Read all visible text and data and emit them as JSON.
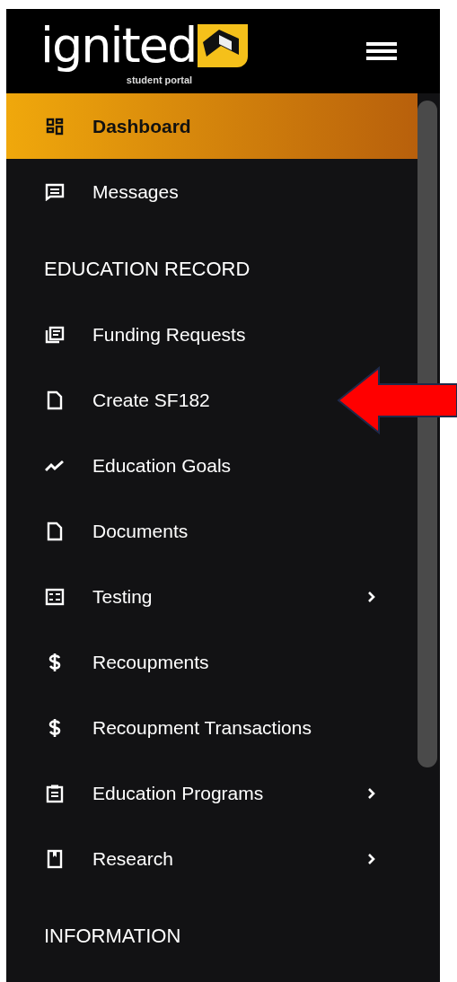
{
  "header": {
    "logo_text": "ignited",
    "logo_subtitle": "student portal"
  },
  "nav": [
    {
      "kind": "link",
      "label": "Dashboard",
      "selected": true,
      "submenu": false
    },
    {
      "kind": "link",
      "label": "Messages",
      "selected": false,
      "submenu": false
    },
    {
      "kind": "heading",
      "label": "EDUCATION RECORD"
    },
    {
      "kind": "link",
      "label": "Funding Requests",
      "selected": false,
      "submenu": false
    },
    {
      "kind": "link",
      "label": "Create SF182",
      "selected": false,
      "submenu": false
    },
    {
      "kind": "link",
      "label": "Education Goals",
      "selected": false,
      "submenu": false
    },
    {
      "kind": "link",
      "label": "Documents",
      "selected": false,
      "submenu": false
    },
    {
      "kind": "link",
      "label": "Testing",
      "selected": false,
      "submenu": true
    },
    {
      "kind": "link",
      "label": "Recoupments",
      "selected": false,
      "submenu": false
    },
    {
      "kind": "link",
      "label": "Recoupment Transactions",
      "selected": false,
      "submenu": false
    },
    {
      "kind": "link",
      "label": "Education Programs",
      "selected": false,
      "submenu": true
    },
    {
      "kind": "link",
      "label": "Research",
      "selected": false,
      "submenu": true
    },
    {
      "kind": "heading",
      "label": "INFORMATION"
    }
  ]
}
